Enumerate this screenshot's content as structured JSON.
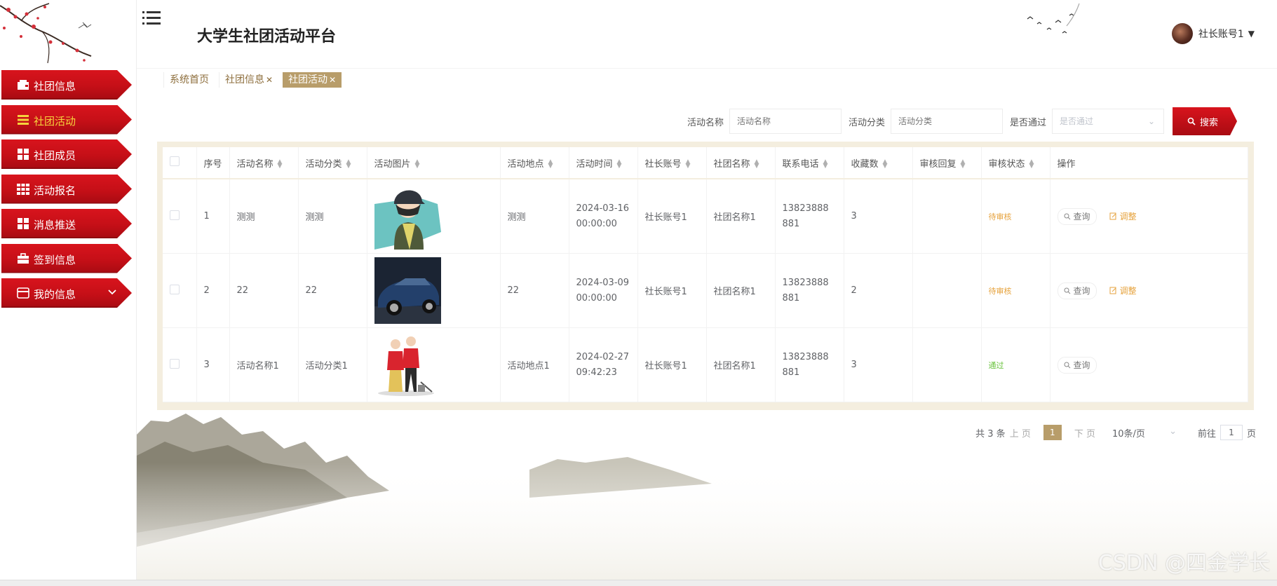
{
  "app": {
    "title": "大学生社团活动平台"
  },
  "user": {
    "name": "社长账号1"
  },
  "sidebar": {
    "items": [
      {
        "label": "社团信息",
        "icon": "wallet-icon"
      },
      {
        "label": "社团活动",
        "icon": "list-icon",
        "active": true
      },
      {
        "label": "社团成员",
        "icon": "grid-icon"
      },
      {
        "label": "活动报名",
        "icon": "apps-icon"
      },
      {
        "label": "消息推送",
        "icon": "grid-icon"
      },
      {
        "label": "签到信息",
        "icon": "briefcase-icon"
      },
      {
        "label": "我的信息",
        "icon": "card-icon",
        "expandable": true
      }
    ]
  },
  "tabs": [
    {
      "label": "系统首页",
      "closable": false
    },
    {
      "label": "社团信息",
      "closable": true
    },
    {
      "label": "社团活动",
      "closable": true,
      "active": true
    }
  ],
  "search": {
    "name_label": "活动名称",
    "name_placeholder": "活动名称",
    "category_label": "活动分类",
    "category_placeholder": "活动分类",
    "approved_label": "是否通过",
    "approved_placeholder": "是否通过",
    "button_label": "搜索"
  },
  "table": {
    "headers": [
      "序号",
      "活动名称",
      "活动分类",
      "活动图片",
      "活动地点",
      "活动时间",
      "社长账号",
      "社团名称",
      "联系电话",
      "收藏数",
      "审核回复",
      "审核状态",
      "操作"
    ],
    "rows": [
      {
        "index": "1",
        "name": "测测",
        "category": "测测",
        "image": "boy-cartoon",
        "location": "测测",
        "time_date": "2024-03-16",
        "time_clock": "00:00:00",
        "account": "社长账号1",
        "club": "社团名称1",
        "phone": "13823888881",
        "favorites": "3",
        "reply": "",
        "status": "待审核",
        "status_type": "pending",
        "actions": [
          "查询",
          "调整"
        ]
      },
      {
        "index": "2",
        "name": "22",
        "category": "22",
        "image": "blue-car",
        "location": "22",
        "time_date": "2024-03-09",
        "time_clock": "00:00:00",
        "account": "社长账号1",
        "club": "社团名称1",
        "phone": "13823888881",
        "favorites": "2",
        "reply": "",
        "status": "待审核",
        "status_type": "pending",
        "actions": [
          "查询",
          "调整"
        ]
      },
      {
        "index": "3",
        "name": "活动名称1",
        "category": "活动分类1",
        "image": "volunteers",
        "location": "活动地点1",
        "time_date": "2024-02-27",
        "time_clock": "09:42:23",
        "account": "社长账号1",
        "club": "社团名称1",
        "phone": "13823888881",
        "favorites": "3",
        "reply": "",
        "status": "通过",
        "status_type": "passed",
        "actions": [
          "查询"
        ]
      }
    ]
  },
  "pagination": {
    "total": "共 3 条",
    "prev": "上 页",
    "current": "1",
    "next": "下 页",
    "page_size": "10条/页",
    "goto_label": "前往",
    "goto_value": "1",
    "goto_suffix": "页"
  },
  "watermark": "CSDN @四金学长",
  "colors": {
    "primary_red": "#c8101a",
    "active_gold": "#f5d33c",
    "tab_active": "#b89d6a",
    "pending": "#e6a23c",
    "passed": "#67c23a"
  }
}
